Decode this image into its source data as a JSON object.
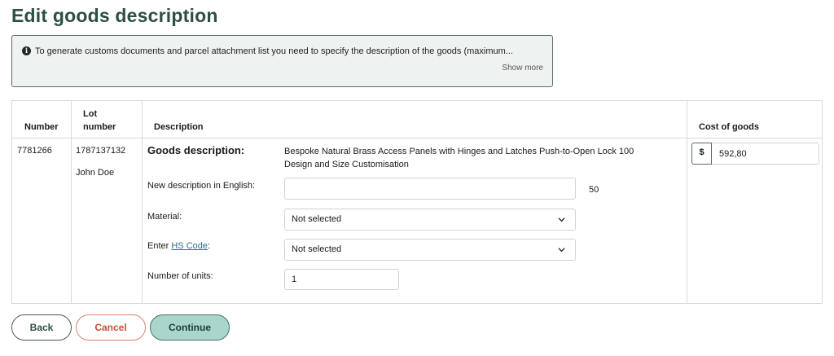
{
  "page": {
    "title": "Edit goods description"
  },
  "info": {
    "icon": "info-circle-icon",
    "text": "To generate customs documents and parcel attachment list you need to specify the description of the goods (maximum...",
    "show_more": "Show more"
  },
  "table": {
    "headers": {
      "number": "Number",
      "lot_line1": "Lot",
      "lot_line2": "number",
      "description": "Description",
      "cost": "Cost of goods"
    },
    "row": {
      "number": "7781266",
      "lot_number": "1787137132",
      "recipient": "John Doe",
      "goods_label": "Goods description:",
      "goods_value": "Bespoke Natural Brass Access Panels with Hinges and Latches Push-to-Open Lock 100 Design and Size Customisation",
      "new_desc_label": "New description in English:",
      "new_desc_value": "",
      "char_count": "50",
      "material_label": "Material:",
      "material_value": "Not selected",
      "hs_label_prefix": "Enter ",
      "hs_label_link": "HS Code",
      "hs_label_suffix": ":",
      "hs_value": "Not selected",
      "units_label": "Number of units:",
      "units_value": "1",
      "currency": "$",
      "cost_value": "592,80"
    }
  },
  "buttons": {
    "back": "Back",
    "cancel": "Cancel",
    "continue": "Continue"
  }
}
